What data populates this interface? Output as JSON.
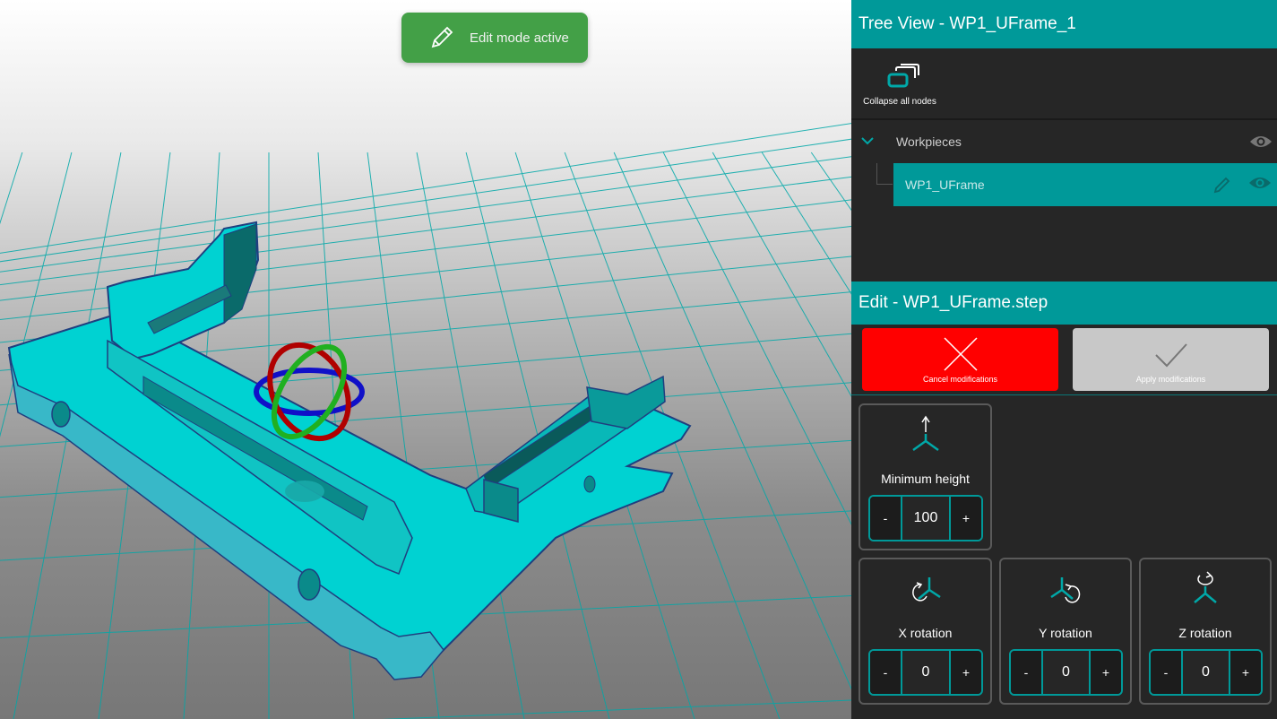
{
  "viewport": {
    "toast_label": "Edit mode active",
    "toast_icon": "pencil-icon",
    "toast_color": "#43a047",
    "model_color": "#00d8d8",
    "grid_color": "#00a8a8"
  },
  "tree": {
    "title": "Tree View - WP1_UFrame_1",
    "collapse_label": "Collapse all nodes",
    "collapse_icon": "stacked-windows-icon",
    "workpieces_label": "Workpieces",
    "uframe_label": "WP1_UFrame",
    "accent": "#009999"
  },
  "edit": {
    "title": "Edit - WP1_UFrame.step",
    "cancel_label": "Cancel modifications",
    "apply_label": "Apply modifications",
    "cancel_color": "#ff0000",
    "apply_color": "#c8c8c8",
    "min_height": {
      "title": "Minimum height",
      "value": "100",
      "minus": "-",
      "plus": "+"
    },
    "x_rotation": {
      "title": "X rotation",
      "value": "0",
      "minus": "-",
      "plus": "+"
    },
    "y_rotation": {
      "title": "Y rotation",
      "value": "0",
      "minus": "-",
      "plus": "+"
    },
    "z_rotation": {
      "title": "Z rotation",
      "value": "0",
      "minus": "-",
      "plus": "+"
    }
  }
}
